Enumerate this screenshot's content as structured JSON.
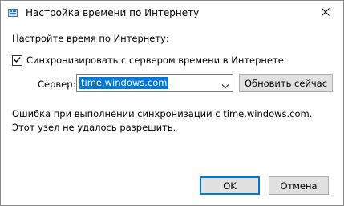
{
  "window": {
    "title": "Настройка времени по Интернету",
    "icon": "clock-globe-icon",
    "close_glyph": "✕"
  },
  "dialog": {
    "heading": "Настройте время по Интернету:",
    "sync_checkbox": {
      "label": "Синхронизировать с сервером времени в Интернете",
      "checked": true
    },
    "server": {
      "label": "Сервер:",
      "value": "time.windows.com"
    },
    "update_button": "Обновить сейчас",
    "error_message": "Ошибка при выполнении синхронизации с time.windows.com.  Этот узел не удалось разрешить.",
    "ok_button": "OK",
    "cancel_button": "Отмена"
  },
  "colors": {
    "accent": "#0078d7",
    "button_face": "#e1e1e1",
    "button_border": "#adadad"
  }
}
